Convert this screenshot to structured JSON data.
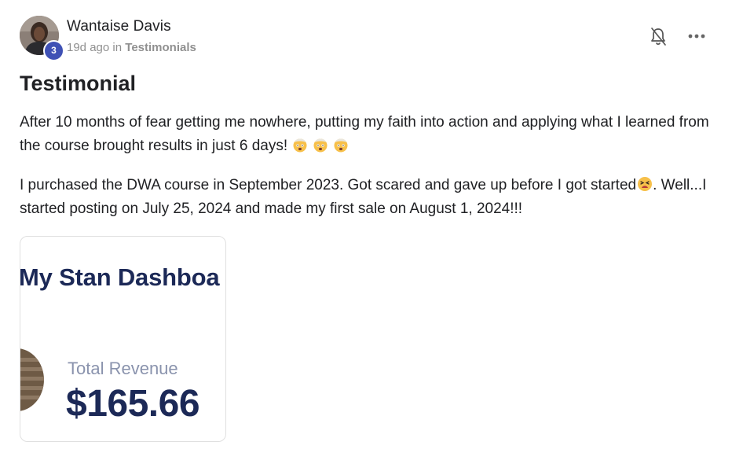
{
  "author": {
    "name": "Wantaise Davis",
    "level": "3",
    "time_ago": "19d ago",
    "in_word": "in",
    "category": "Testimonials",
    "avatar_icon": "user-avatar-photo"
  },
  "actions": {
    "bell_icon": "bell-off-icon",
    "more_icon": "more-horizontal-icon"
  },
  "post": {
    "title": "Testimonial",
    "paragraph1_text": "After 10 months of fear getting me nowhere, putting my faith into action and applying what I learned from the course brought results in just 6 days!",
    "paragraph1_emoji": [
      "exploding-head-emoji",
      "exploding-head-emoji",
      "exploding-head-emoji"
    ],
    "paragraph2_text_a": "I purchased the DWA course in September 2023. Got scared and gave up before I got started",
    "paragraph2_emoji": "tired-face-emoji",
    "paragraph2_text_b": ". Well...I started posting on July 25, 2024 and made my first sale on August 1, 2024!!!"
  },
  "attachment": {
    "heading": "My Stan Dashboa",
    "label": "Total Revenue",
    "value": "$165.66"
  },
  "colors": {
    "text": "#202124",
    "muted": "#909090",
    "badge": "#3f51b5",
    "dashboard_navy": "#1c2957",
    "dashboard_label": "#8a93ad"
  }
}
